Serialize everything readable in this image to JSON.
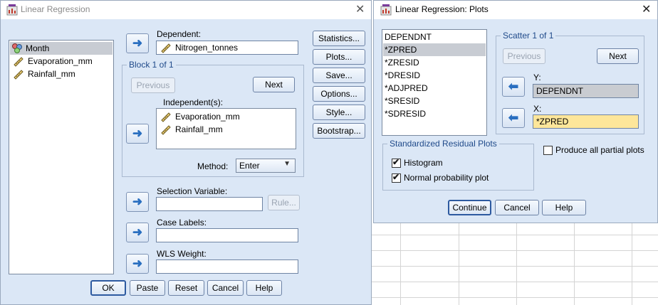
{
  "main_dialog": {
    "title": "Linear Regression",
    "variables": [
      {
        "name": "Month",
        "icon": "nominal-icon",
        "selected": true
      },
      {
        "name": "Evaporation_mm",
        "icon": "scale-ruler-icon",
        "selected": false
      },
      {
        "name": "Rainfall_mm",
        "icon": "scale-ruler-icon",
        "selected": false
      }
    ],
    "dependent_label": "Dependent:",
    "dependent_value": "Nitrogen_tonnes",
    "block_label": "Block 1 of 1",
    "previous_label": "Previous",
    "next_label": "Next",
    "independents_label": "Independent(s):",
    "independents": [
      "Evaporation_mm",
      "Rainfall_mm"
    ],
    "method_label": "Method:",
    "method_value": "Enter",
    "selection_label": "Selection Variable:",
    "rule_label": "Rule...",
    "case_labels_label": "Case Labels:",
    "wls_label": "WLS Weight:",
    "side_buttons": [
      "Statistics...",
      "Plots...",
      "Save...",
      "Options...",
      "Style...",
      "Bootstrap..."
    ],
    "bottom_buttons": [
      "OK",
      "Paste",
      "Reset",
      "Cancel",
      "Help"
    ]
  },
  "plots_dialog": {
    "title": "Linear Regression: Plots",
    "variables": [
      "DEPENDNT",
      "*ZPRED",
      "*ZRESID",
      "*DRESID",
      "*ADJPRED",
      "*SRESID",
      "*SDRESID"
    ],
    "scatter_label": "Scatter 1 of 1",
    "previous_label": "Previous",
    "next_label": "Next",
    "y_label": "Y:",
    "y_value": "DEPENDNT",
    "x_label": "X:",
    "x_value": "*ZPRED",
    "std_resid_label": "Standardized Residual Plots",
    "histogram_label": "Histogram",
    "histogram_checked": true,
    "normal_prob_label": "Normal probability plot",
    "normal_prob_checked": true,
    "partial_plots_label": "Produce all partial plots",
    "partial_plots_checked": false,
    "buttons": [
      "Continue",
      "Cancel",
      "Help"
    ]
  },
  "colors": {
    "dialog_bg": "#dbe7f6",
    "accent": "#2a6fc0",
    "x_field_bg": "#fde69a",
    "y_field_bg": "#c9ccd1"
  }
}
